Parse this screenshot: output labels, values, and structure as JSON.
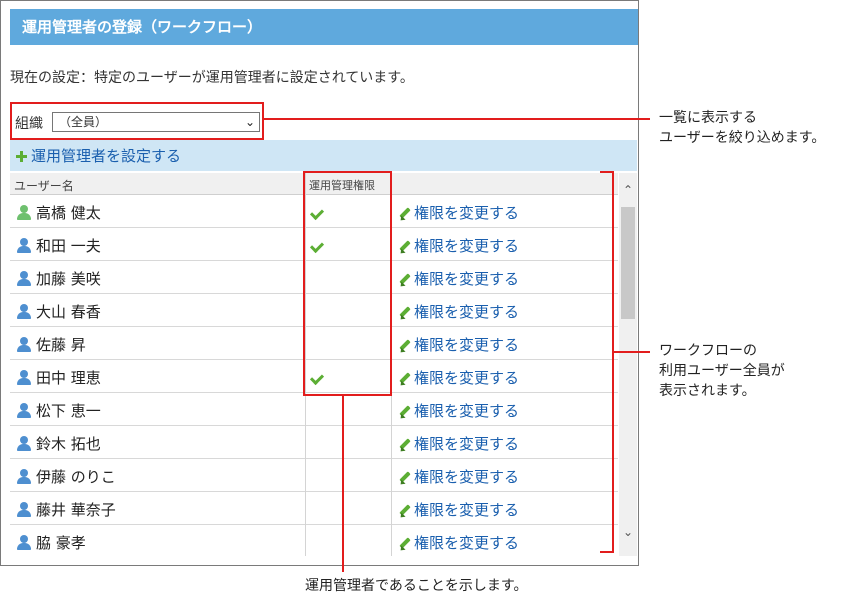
{
  "header": {
    "title": "運用管理者の登録（ワークフロー）"
  },
  "current_setting": "現在の設定：特定のユーザーが運用管理者に設定されています。",
  "org_filter": {
    "label": "組織",
    "selected": "（全員）"
  },
  "set_admin_link": "運用管理者を設定する",
  "table": {
    "columns": {
      "user_name": "ユーザー名",
      "admin_rights": "運用管理権限"
    },
    "change_label": "権限を変更する",
    "rows": [
      {
        "name": "高橋 健太",
        "admin": true,
        "icon_color": "green"
      },
      {
        "name": "和田 一夫",
        "admin": true,
        "icon_color": "blue"
      },
      {
        "name": "加藤 美咲",
        "admin": false,
        "icon_color": "blue"
      },
      {
        "name": "大山 春香",
        "admin": false,
        "icon_color": "blue"
      },
      {
        "name": "佐藤 昇",
        "admin": false,
        "icon_color": "blue"
      },
      {
        "name": "田中 理恵",
        "admin": true,
        "icon_color": "blue"
      },
      {
        "name": "松下 恵一",
        "admin": false,
        "icon_color": "blue"
      },
      {
        "name": "鈴木 拓也",
        "admin": false,
        "icon_color": "blue"
      },
      {
        "name": "伊藤 のりこ",
        "admin": false,
        "icon_color": "blue"
      },
      {
        "name": "藤井 華奈子",
        "admin": false,
        "icon_color": "blue"
      },
      {
        "name": "脇 豪孝",
        "admin": false,
        "icon_color": "blue"
      }
    ]
  },
  "annotations": {
    "filter_line1": "一覧に表示する",
    "filter_line2": "ユーザーを絞り込めます。",
    "list_line1": "ワークフローの",
    "list_line2": "利用ユーザー全員が",
    "list_line3": "表示されます。",
    "admin_note": "運用管理者であることを示します。"
  },
  "colors": {
    "accent": "#5fa9dd",
    "highlight": "#e21d1d",
    "link": "#1a5fae",
    "check": "#5cae34"
  }
}
